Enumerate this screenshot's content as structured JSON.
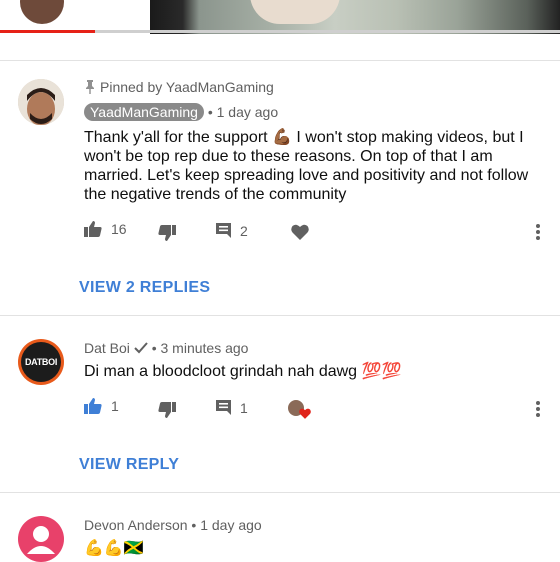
{
  "colors": {
    "link_blue": "#3f7fd6",
    "meta_gray": "#606060",
    "heart_red": "#e0241b",
    "datboi_orange": "#e85a1b",
    "avatar_pink": "#e8416a"
  },
  "pinned_comment": {
    "pinned_label": "Pinned by YaadManGaming",
    "author": "YaadManGaming",
    "time": "1 day ago",
    "text": "Thank y'all for the support 💪🏾 I won't stop making videos, but I won't be top rep due to these reasons. On top of that I am married. Let's keep spreading love and positivity and not follow the negative trends of the community",
    "likes": "16",
    "replies_count": "2",
    "view_replies": "VIEW 2 REPLIES"
  },
  "comment_2": {
    "author": "Dat Boi",
    "time": "3 minutes ago",
    "avatar_text": "DATBOI",
    "text": "Di man a bloodcloot grindah nah dawg 💯💯",
    "likes": "1",
    "replies_count": "1",
    "view_replies": "VIEW REPLY"
  },
  "comment_3": {
    "author": "Devon Anderson",
    "time": "1 day ago",
    "text": "💪💪🇯🇲"
  },
  "separator": "•",
  "icons": [
    "pin-icon",
    "thumbs-up-icon",
    "thumbs-down-icon",
    "reply-icon",
    "heart-icon",
    "more-vert-icon",
    "verified-check-icon"
  ]
}
